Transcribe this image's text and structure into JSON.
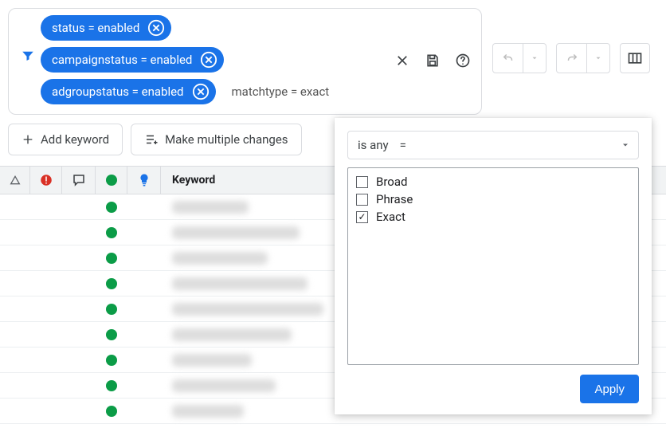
{
  "filters": {
    "chips": [
      "status = enabled",
      "campaignstatus = enabled",
      "adgroupstatus = enabled"
    ],
    "pending": "matchtype = exact"
  },
  "toolbar": {
    "add_keyword": "Add keyword",
    "make_changes": "Make multiple changes"
  },
  "grid": {
    "header_keyword": "Keyword",
    "rows": [
      {
        "blur_width": 96
      },
      {
        "blur_width": 160
      },
      {
        "blur_width": 120
      },
      {
        "blur_width": 170
      },
      {
        "blur_width": 190
      },
      {
        "blur_width": 150
      },
      {
        "blur_width": 100
      },
      {
        "blur_width": 130
      },
      {
        "blur_width": 90
      }
    ]
  },
  "dropdown": {
    "operator": "is any",
    "operator_symbol": "=",
    "options": [
      {
        "label": "Broad",
        "checked": false
      },
      {
        "label": "Phrase",
        "checked": false
      },
      {
        "label": "Exact",
        "checked": true
      }
    ],
    "apply": "Apply"
  },
  "colors": {
    "primary": "#1a73e8",
    "status_green": "#0b9c47",
    "error_red": "#d93025",
    "rec_blue": "#1a73e8"
  }
}
